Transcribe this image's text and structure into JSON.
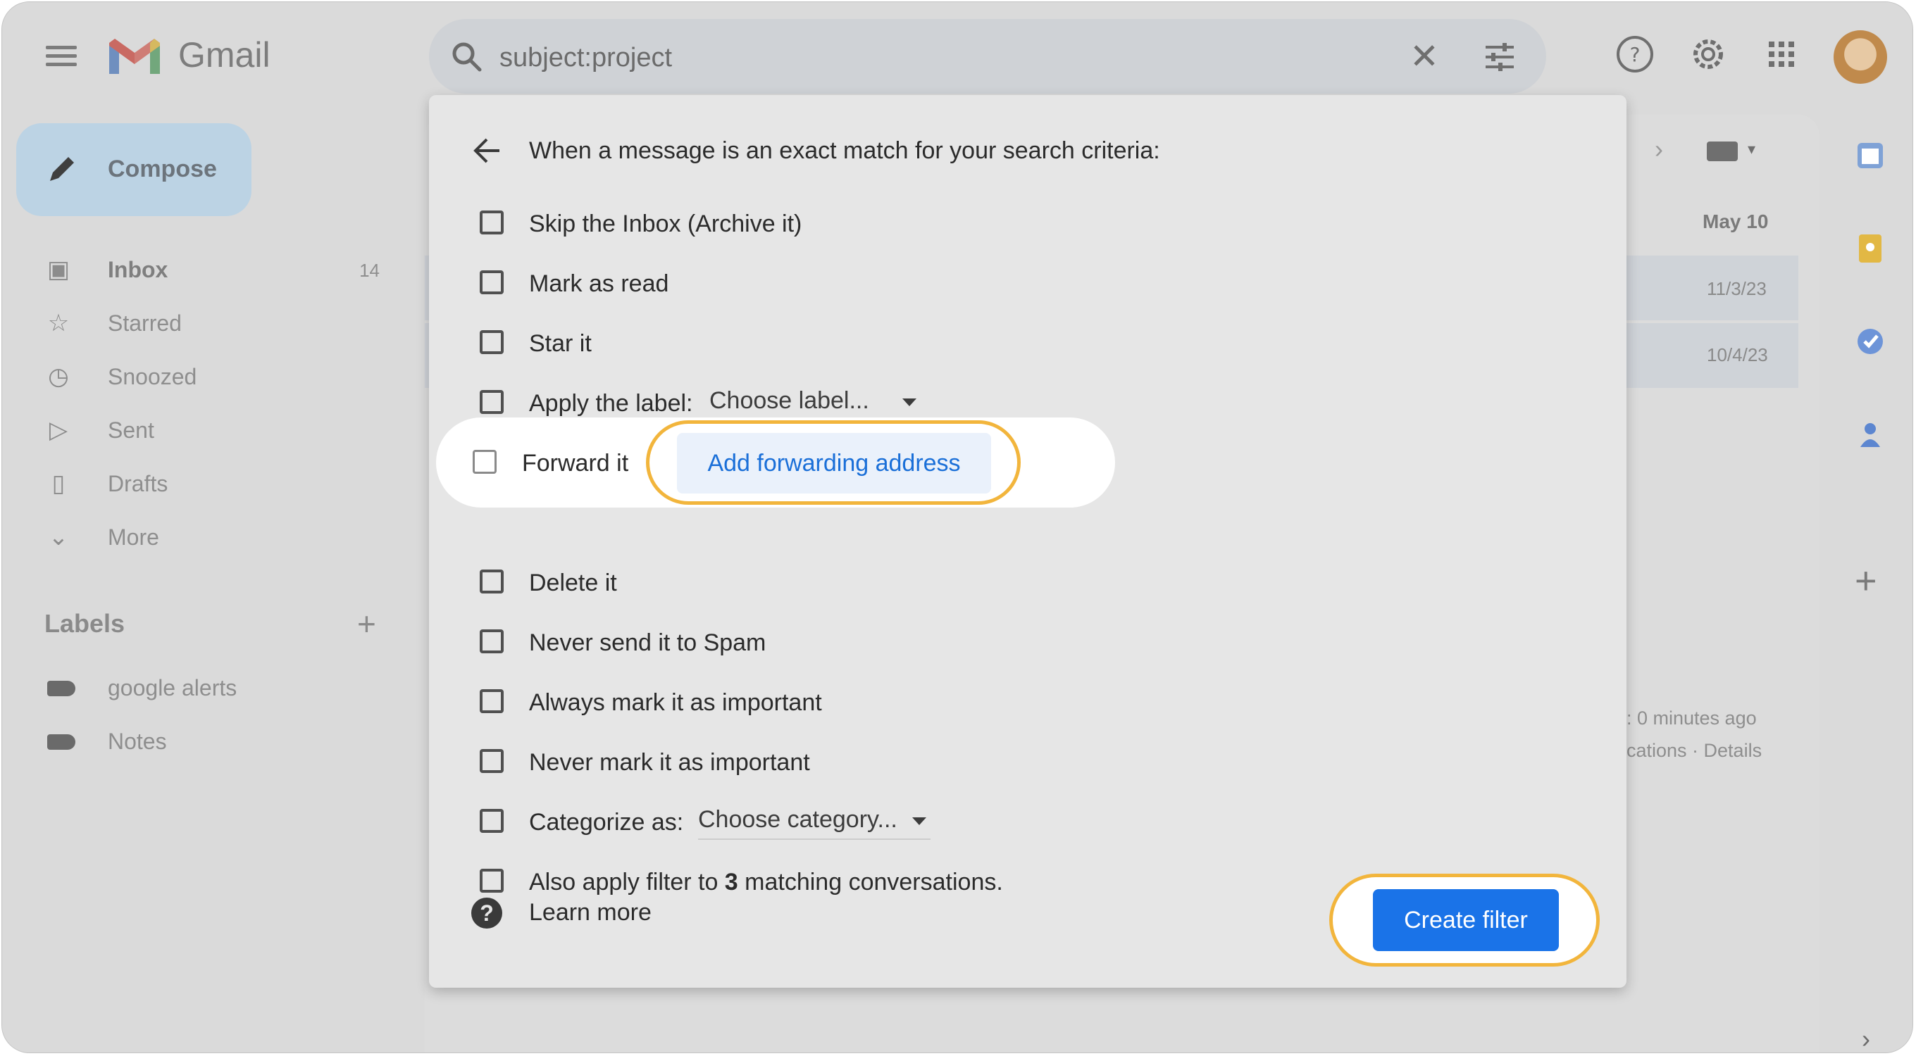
{
  "app": {
    "name": "Gmail",
    "search_query": "subject:project"
  },
  "sidebar": {
    "compose_label": "Compose",
    "items": [
      {
        "label": "Inbox",
        "count": "14",
        "icon": "inbox-icon"
      },
      {
        "label": "Starred",
        "count": "",
        "icon": "star-icon"
      },
      {
        "label": "Snoozed",
        "count": "",
        "icon": "clock-icon"
      },
      {
        "label": "Sent",
        "count": "",
        "icon": "send-icon"
      },
      {
        "label": "Drafts",
        "count": "",
        "icon": "draft-icon"
      },
      {
        "label": "More",
        "count": "",
        "icon": "chevron-down-icon"
      }
    ],
    "labels_heading": "Labels",
    "labels": [
      {
        "name": "google alerts"
      },
      {
        "name": "Notes"
      }
    ]
  },
  "message_list": {
    "date_header": "May 10",
    "rows": [
      {
        "date": "11/3/23"
      },
      {
        "date": "10/4/23"
      }
    ],
    "activity_line1": ": 0 minutes ago",
    "activity_line2": "cations · Details"
  },
  "filter_dialog": {
    "title": "When a message is an exact match for your search criteria:",
    "options": {
      "skip_inbox": "Skip the Inbox (Archive it)",
      "mark_read": "Mark as read",
      "star_it": "Star it",
      "apply_label": "Apply the label:",
      "apply_label_select": "Choose label...",
      "forward_it": "Forward it",
      "add_forwarding": "Add forwarding address",
      "delete_it": "Delete it",
      "never_spam": "Never send it to Spam",
      "always_important": "Always mark it as important",
      "never_important": "Never mark it as important",
      "categorize_as": "Categorize as:",
      "categorize_select": "Choose category...",
      "also_apply_prefix": "Also apply filter to ",
      "also_apply_count": "3",
      "also_apply_suffix": " matching conversations."
    },
    "learn_more": "Learn more",
    "create_filter": "Create filter"
  },
  "colors": {
    "accent": "#1a73e8",
    "highlight_ring": "#f2b53c",
    "dialog_bg": "#e6e6e6",
    "link": "#1a6fd8"
  }
}
